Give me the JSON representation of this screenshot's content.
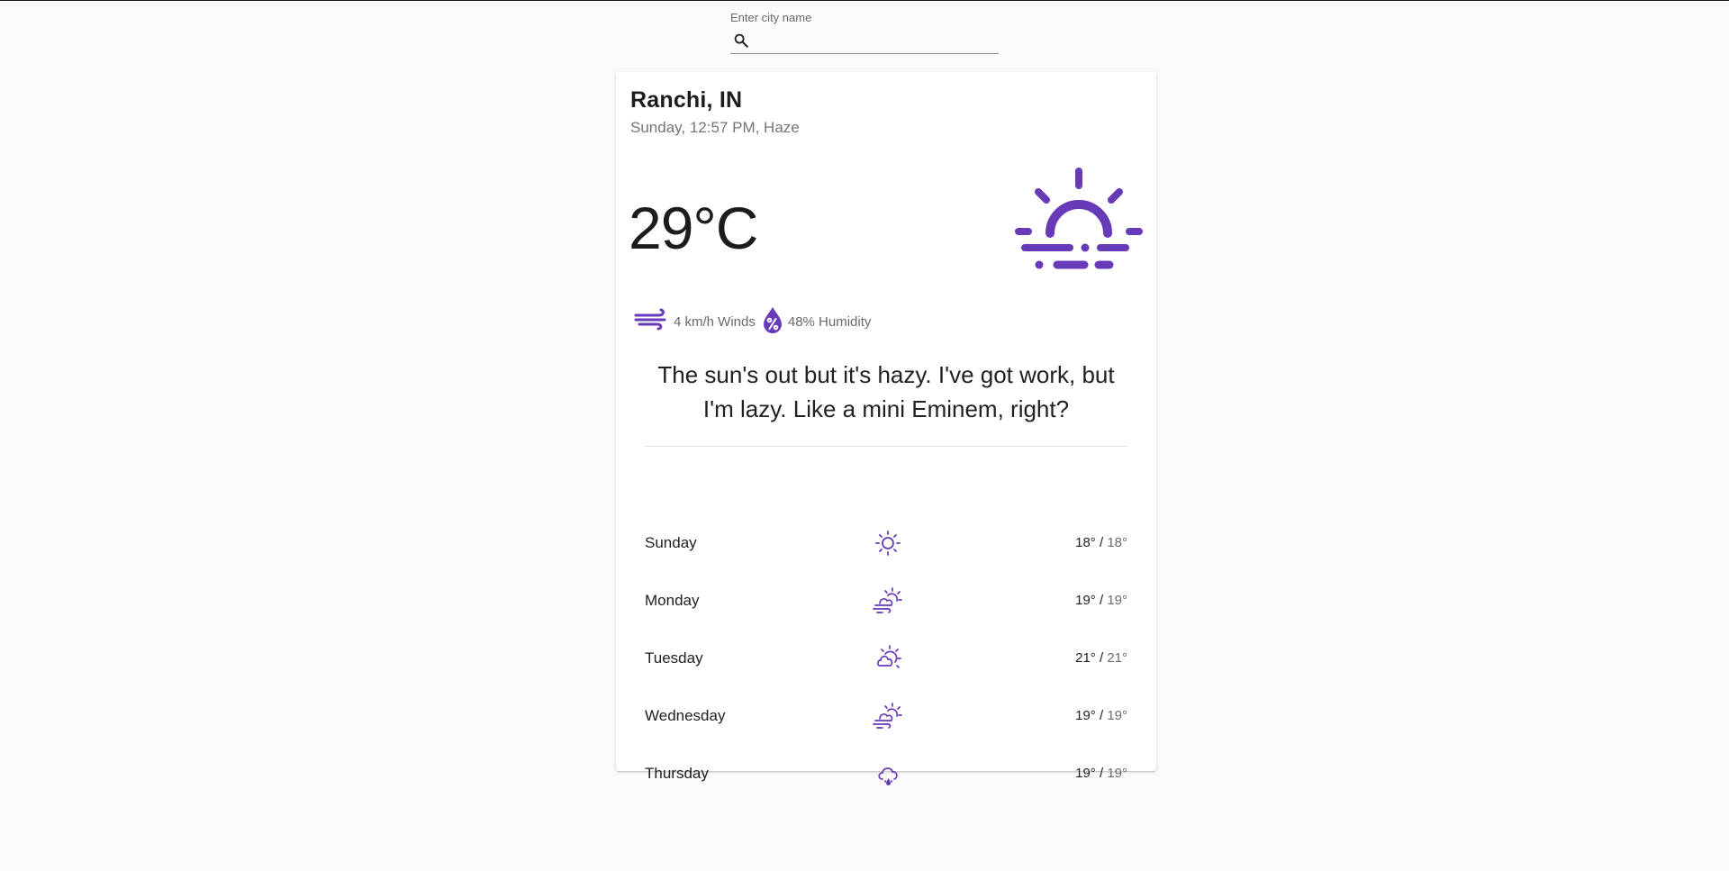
{
  "search": {
    "label": "Enter city name",
    "value": "",
    "placeholder": ""
  },
  "weather": {
    "city": "Ranchi, IN",
    "subtitle": "Sunday, 12:57 PM, Haze",
    "temperature": "29°C",
    "main_icon": "haze-icon",
    "wind": "4 km/h Winds",
    "humidity": "48% Humidity",
    "quote": "The sun's out but it's hazy. I've got work, but I'm lazy. Like a mini Eminem, right?"
  },
  "forecast": [
    {
      "day": "Sunday",
      "icon": "sun-icon",
      "high": "18°",
      "sep": " / ",
      "low": "18°"
    },
    {
      "day": "Monday",
      "icon": "windy-partly-cloudy-icon",
      "high": "19°",
      "sep": " / ",
      "low": "19°"
    },
    {
      "day": "Tuesday",
      "icon": "partly-cloudy-icon",
      "high": "21°",
      "sep": " / ",
      "low": "21°"
    },
    {
      "day": "Wednesday",
      "icon": "windy-partly-cloudy-icon",
      "high": "19°",
      "sep": " / ",
      "low": "19°"
    },
    {
      "day": "Thursday",
      "icon": "rain-cloud-icon",
      "high": "19°",
      "sep": " / ",
      "low": "19°"
    }
  ],
  "colors": {
    "accent": "#673ab7",
    "background": "#fafafa",
    "card": "#ffffff"
  }
}
